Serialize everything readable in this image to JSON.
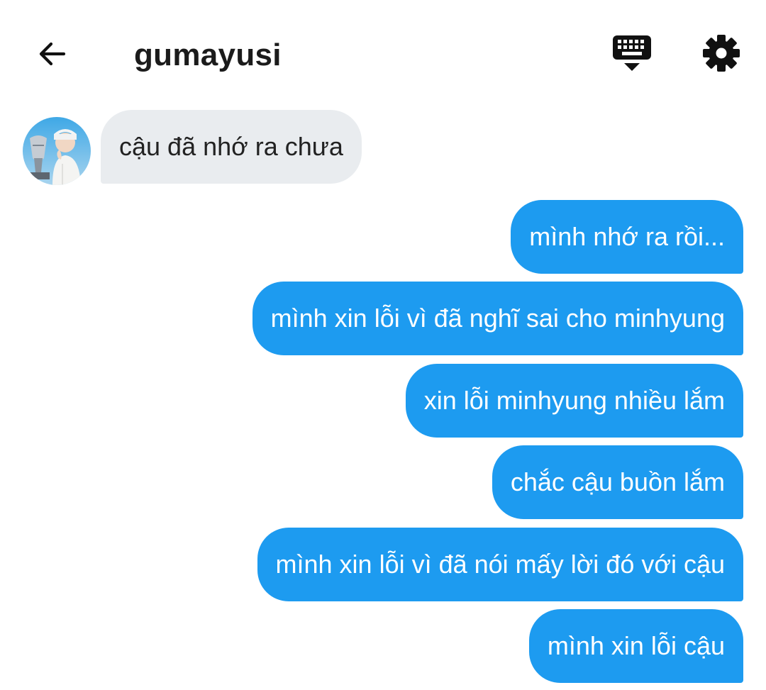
{
  "header": {
    "title": "gumayusi",
    "back_icon": "arrow-left-icon",
    "keyboard_icon": "keyboard-hide-icon",
    "settings_icon": "gear-icon"
  },
  "conversation": {
    "incoming": [
      {
        "text": "cậu đã nhớ ra chưa"
      }
    ],
    "outgoing": [
      {
        "text": "mình nhớ ra rồi..."
      },
      {
        "text": "mình xin lỗi vì đã nghĩ sai cho minhyung"
      },
      {
        "text": "xin lỗi minhyung nhiều lắm"
      },
      {
        "text": "chắc cậu buồn lắm"
      },
      {
        "text": "mình xin lỗi vì đã nói mấy lời đó với cậu"
      },
      {
        "text": "mình xin lỗi cậu"
      }
    ]
  },
  "colors": {
    "outgoing_bubble": "#1d9bf0",
    "incoming_bubble": "#e9ecef",
    "text_dark": "#222222"
  }
}
